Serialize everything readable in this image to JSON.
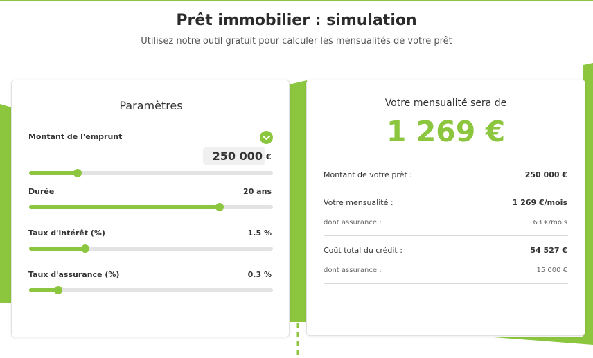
{
  "colors": {
    "accent": "#8cc63f",
    "text": "#2f2f2f",
    "muted": "#666666",
    "track": "#e3e3e3"
  },
  "header": {
    "title": "Prêt immobilier : simulation",
    "subtitle": "Utilisez notre outil gratuit pour calculer les mensualités de votre prêt"
  },
  "params": {
    "title": "Paramètres",
    "check_icon": "check-circle-icon",
    "loan_amount": {
      "label": "Montant de l'emprunt",
      "value": "250 000",
      "unit": "€",
      "slider_level": 0.2
    },
    "duration": {
      "label": "Durée",
      "value": "20 ans",
      "slider_level": 0.78
    },
    "interest_rate": {
      "label": "Taux d'intérêt (%)",
      "value": "1.5 %",
      "slider_level": 0.23
    },
    "insurance_rate": {
      "label": "Taux d'assurance (%)",
      "value": "0.3 %",
      "slider_level": 0.12
    }
  },
  "result": {
    "title": "Votre mensualité sera de",
    "amount": "1 269 €",
    "loan_label": "Montant de votre prêt :",
    "loan_value": "250 000 €",
    "monthly_label": "Votre mensualité :",
    "monthly_value": "1 269 €/mois",
    "monthly_insurance_label": "dont assurance :",
    "monthly_insurance_value": "63 €/mois",
    "total_cost_label": "Coût total du crédit :",
    "total_cost_value": "54 527 €",
    "total_insurance_label": "dont assurance :",
    "total_insurance_value": "15 000 €"
  }
}
